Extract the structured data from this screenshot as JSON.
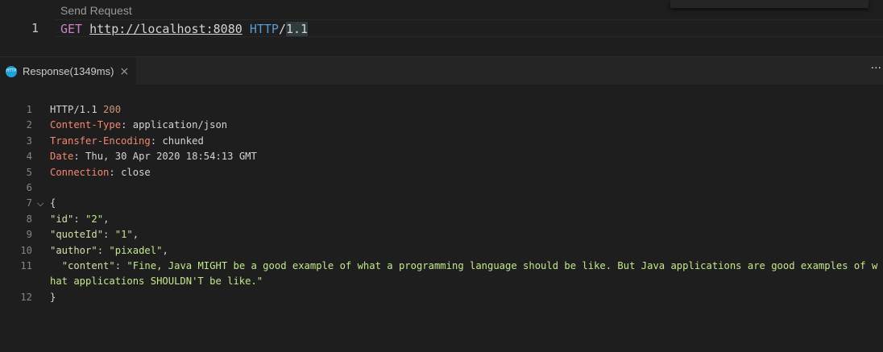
{
  "request_editor": {
    "codelens": "Send Request",
    "line_number": "1",
    "method": "GET",
    "url": "http://localhost:8080",
    "protocol": "HTTP",
    "slash": "/",
    "version": "1.1"
  },
  "tab": {
    "label": "Response(1349ms)",
    "icon_text": "HTTP",
    "close": "×"
  },
  "more_actions": "···",
  "response": {
    "line_numbers": [
      "1",
      "2",
      "3",
      "4",
      "5",
      "6",
      "7",
      "8",
      "9",
      "10",
      "11",
      "12"
    ],
    "status_line": {
      "protocol": "HTTP/1.1",
      "code": "200"
    },
    "headers": [
      {
        "name": "Content-Type",
        "value": "application/json"
      },
      {
        "name": "Transfer-Encoding",
        "value": "chunked"
      },
      {
        "name": "Date",
        "value": "Thu, 30 Apr 2020 18:54:13 GMT"
      },
      {
        "name": "Connection",
        "value": "close"
      }
    ],
    "fold_icon": "⌵",
    "open_brace": "{",
    "close_brace": "}",
    "body": [
      {
        "key": "\"id\"",
        "value": "\"2\"",
        "trail": ","
      },
      {
        "key": "\"quoteId\"",
        "value": "\"1\"",
        "trail": ","
      },
      {
        "key": "\"author\"",
        "value": "\"pixadel\"",
        "trail": ","
      },
      {
        "key": "\"content\"",
        "value": "\"Fine, Java MIGHT be a good example of what a programming language should be like. But Java applications are good examples of what applications SHOULDN'T be like.\"",
        "trail": ""
      }
    ]
  },
  "colors": {
    "background": "#1e1e1e",
    "tab_bar": "#252526",
    "method": "#c586c0",
    "protocol": "#569cd6",
    "header_name": "#f48771",
    "status_code": "#ce9178",
    "json_key": "#dcdcaa",
    "json_string": "#c3e88d"
  }
}
